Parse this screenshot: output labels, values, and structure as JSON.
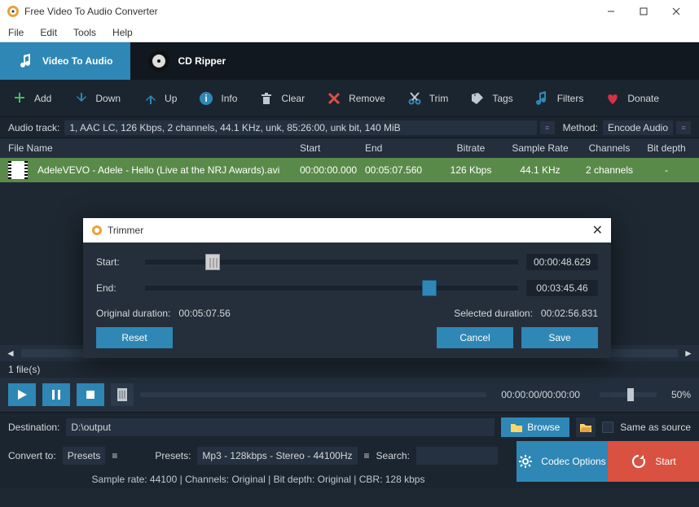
{
  "window": {
    "title": "Free Video To Audio Converter"
  },
  "menubar": [
    "File",
    "Edit",
    "Tools",
    "Help"
  ],
  "tabs": {
    "t0": "Video To Audio",
    "t1": "CD Ripper"
  },
  "toolbar": {
    "add": "Add",
    "down": "Down",
    "up": "Up",
    "info": "Info",
    "clear": "Clear",
    "remove": "Remove",
    "trim": "Trim",
    "tags": "Tags",
    "filters": "Filters",
    "donate": "Donate"
  },
  "audiotrack": {
    "label": "Audio track:",
    "value": "1, AAC LC, 126 Kbps, 2 channels, 44.1 KHz, unk, 85:26:00, unk bit, 140 MiB",
    "method_label": "Method:",
    "method_value": "Encode Audio"
  },
  "columns": {
    "name": "File Name",
    "start": "Start",
    "end": "End",
    "bitrate": "Bitrate",
    "sr": "Sample Rate",
    "ch": "Channels",
    "bd": "Bit depth"
  },
  "row": {
    "name": "AdeleVEVO - Adele - Hello (Live at the NRJ Awards).avi",
    "start": "00:00:00.000",
    "end": "00:05:07.560",
    "bitrate": "126 Kbps",
    "sr": "44.1 KHz",
    "ch": "2 channels",
    "bd": "-"
  },
  "scroll_files": "1 file(s)",
  "playback": {
    "time": "00:00:00/00:00:00",
    "pct": "50%"
  },
  "dest": {
    "label": "Destination:",
    "value": "D:\\output",
    "browse": "Browse",
    "same": "Same as source"
  },
  "convert": {
    "label": "Convert to:",
    "tov": "Presets",
    "presets_label": "Presets:",
    "presets_value": "Mp3 - 128kbps - Stereo - 44100Hz",
    "search_label": "Search:",
    "codec": "Codec Options",
    "start": "Start"
  },
  "status": "Sample rate: 44100 | Channels: Original | Bit depth: Original | CBR: 128 kbps",
  "trimmer": {
    "title": "Trimmer",
    "start_label": "Start:",
    "end_label": "End:",
    "start_time": "00:00:48.629",
    "end_time": "00:03:45.46",
    "orig_label": "Original duration:",
    "orig_value": "00:05:07.56",
    "sel_label": "Selected duration:",
    "sel_value": "00:02:56.831",
    "reset": "Reset",
    "cancel": "Cancel",
    "save": "Save"
  }
}
